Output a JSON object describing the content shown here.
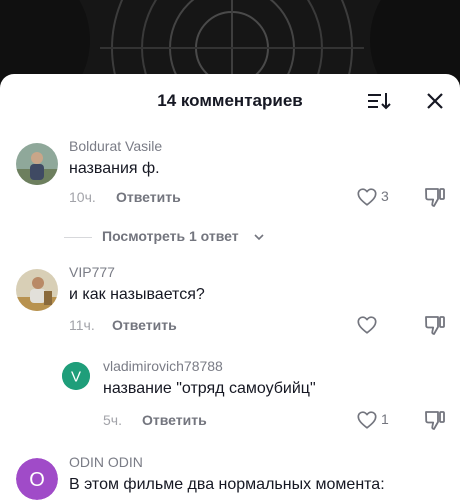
{
  "header": {
    "title": "14 комментариев"
  },
  "icons": {
    "sort": "sort-icon",
    "close": "close-icon",
    "like": "heart-outline-icon",
    "dislike": "thumbs-down-icon",
    "chevron": "chevron-down-icon"
  },
  "comments": [
    {
      "author": "Boldurat Vasile",
      "text": "названия ф.",
      "time": "10ч.",
      "reply_label": "Ответить",
      "likes": "3",
      "view_replies": "Посмотреть 1 ответ"
    },
    {
      "author": "VIP777",
      "text": "и как называется?",
      "time": "11ч.",
      "reply_label": "Ответить",
      "likes": ""
    },
    {
      "author": "vladimirovich78788",
      "avatar_letter": "V",
      "avatar_color": "#1f9e7a",
      "text": "название \"отряд самоубийц\"",
      "time": "5ч.",
      "reply_label": "Ответить",
      "likes": "1"
    },
    {
      "author": "ODIN ODIN",
      "avatar_letter": "O",
      "avatar_color": "#a04bc8",
      "text": "В этом фильме два нормальных момента:"
    }
  ]
}
